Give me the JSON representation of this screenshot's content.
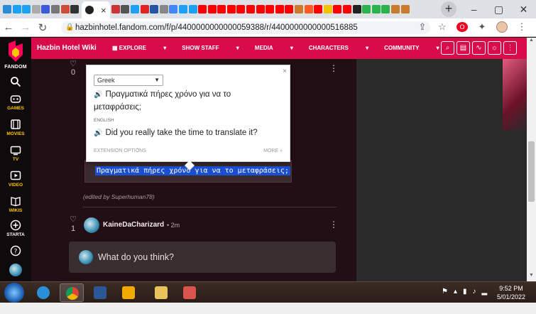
{
  "browser": {
    "url": "hazbinhotel.fandom.com/f/p/4400000000000059388/r/4400000000000516885",
    "tab_favicon_colors": [
      "#2b8bd6",
      "#1da1f2",
      "#1da1f2",
      "#aaaaaa",
      "#3b5bdb",
      "#777777",
      "#d04b3a",
      "#333333",
      "#cc3333",
      "#555555",
      "#1da1f2",
      "#e02424",
      "#2456a6",
      "#888888",
      "#4285f4",
      "#1da1f2",
      "#1da1f2",
      "#ff0000",
      "#ff0000",
      "#ff0000",
      "#ff0000",
      "#ff0000",
      "#ff0000",
      "#ff0000",
      "#ff0000",
      "#ff0000",
      "#ff0000",
      "#c97a2b",
      "#ff5a1f",
      "#ff0000",
      "#f2c300",
      "#ff0000",
      "#ff0000",
      "#222222",
      "#2ab24b",
      "#2ab24b",
      "#2ab24b",
      "#c97a2b",
      "#c97a2b"
    ]
  },
  "wiki": {
    "title": "Hazbin Hotel Wiki",
    "nav": [
      "EXPLORE",
      "SHOW STAFF",
      "MEDIA",
      "CHARACTERS",
      "COMMUNITY"
    ]
  },
  "rail": {
    "brand": "FANDOM",
    "items": [
      "GAMES",
      "MOVIES",
      "TV",
      "VIDEO",
      "WIKIS",
      "STARTA"
    ]
  },
  "post1": {
    "likes": "0",
    "selected_text": "Πραγματικά πήρες χρόνο για να το μεταφράσεις;",
    "edited_note": "(edited by Superhuman78)"
  },
  "reply2": {
    "likes": "1",
    "author": "KaineDaCharizard",
    "time": "2m"
  },
  "compose": {
    "placeholder": "What do you think?"
  },
  "popup": {
    "target_language": "Greek",
    "translation": "Πραγματικά πήρες χρόνο για να το μεταφράσεις;",
    "translation_line1": "Πραγματικά πήρες χρόνο για να το",
    "translation_line2": "μεταφράσεις;",
    "source_language": "ENGLISH",
    "source_text": "Did you really take the time to translate it?",
    "extension_options": "EXTENSION OPTIONS",
    "more": "MORE »",
    "close": "×"
  },
  "taskbar": {
    "time": "9:52 PM",
    "date": "5/01/2022"
  }
}
